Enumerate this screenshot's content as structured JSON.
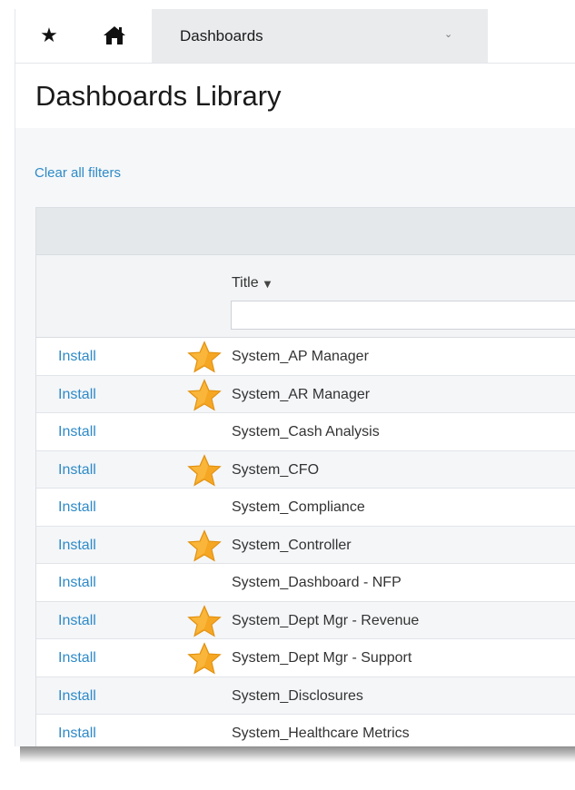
{
  "topbar": {
    "favorites_icon": "star-icon",
    "home_icon": "home-icon",
    "dropdown_label": "Dashboards",
    "dropdown_chevron": "⌄"
  },
  "page_title": "Dashboards Library",
  "clear_filters": "Clear all filters",
  "table": {
    "title_header": "Title",
    "sort_caret": "▼",
    "filter_value": "",
    "rows": [
      {
        "action": "Install",
        "favorite": true,
        "title": "System_AP Manager"
      },
      {
        "action": "Install",
        "favorite": true,
        "title": "System_AR Manager"
      },
      {
        "action": "Install",
        "favorite": false,
        "title": "System_Cash Analysis"
      },
      {
        "action": "Install",
        "favorite": true,
        "title": "System_CFO"
      },
      {
        "action": "Install",
        "favorite": false,
        "title": "System_Compliance"
      },
      {
        "action": "Install",
        "favorite": true,
        "title": "System_Controller"
      },
      {
        "action": "Install",
        "favorite": false,
        "title": "System_Dashboard - NFP"
      },
      {
        "action": "Install",
        "favorite": true,
        "title": "System_Dept Mgr - Revenue"
      },
      {
        "action": "Install",
        "favorite": true,
        "title": "System_Dept Mgr - Support"
      },
      {
        "action": "Install",
        "favorite": false,
        "title": "System_Disclosures"
      },
      {
        "action": "Install",
        "favorite": false,
        "title": "System_Healthcare Metrics"
      }
    ]
  },
  "colors": {
    "link": "#2e8ac7",
    "star_fill": "#f5a623",
    "header_bg": "#e5e8eb"
  }
}
